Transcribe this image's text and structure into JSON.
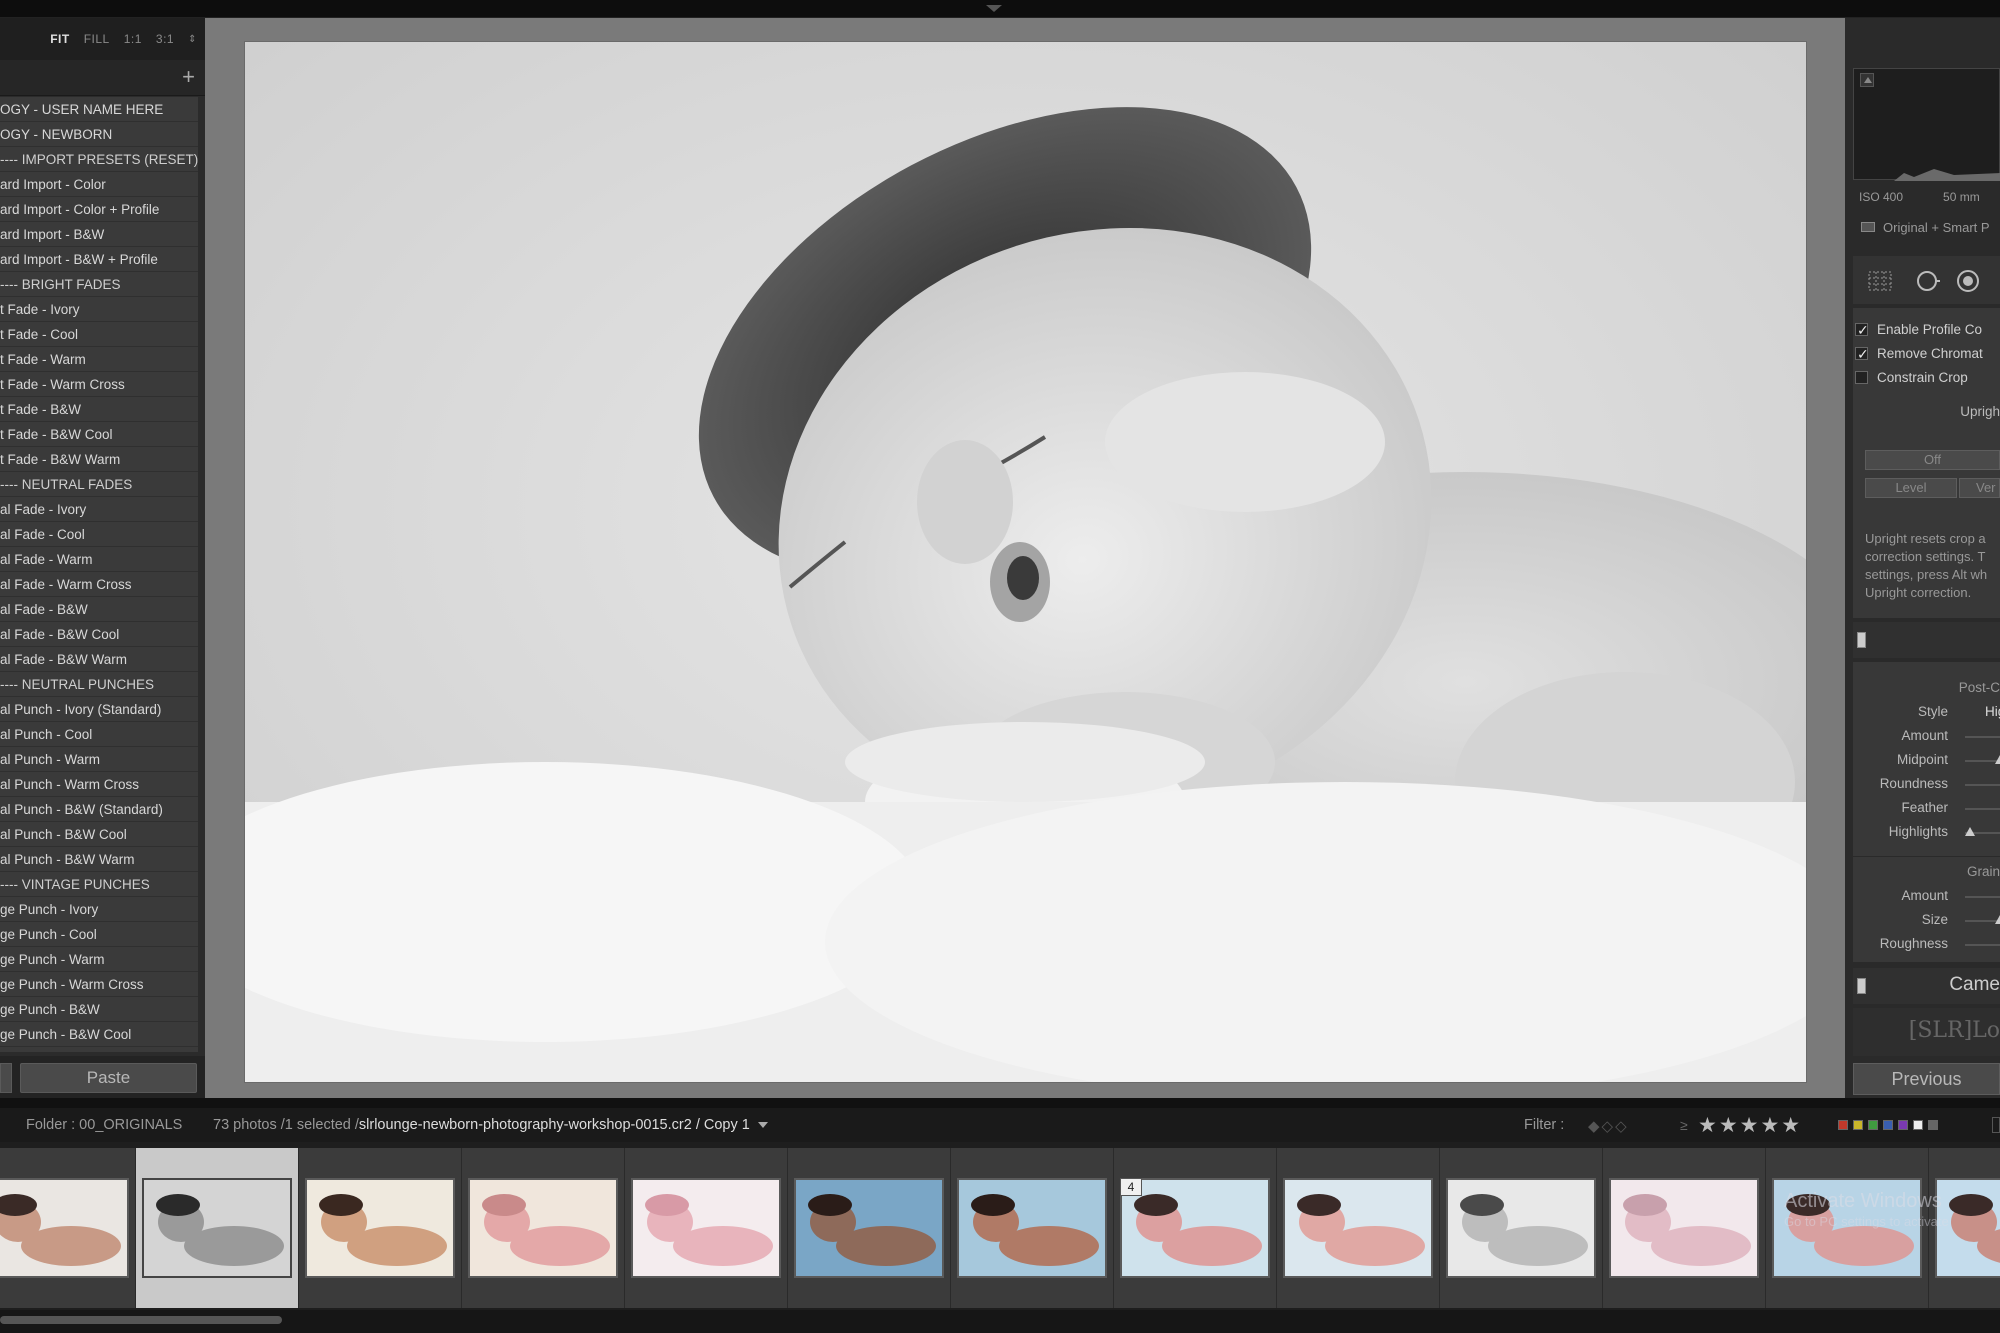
{
  "zoom": {
    "fit": "FIT",
    "fill": "FILL",
    "one": "1:1",
    "three": "3:1"
  },
  "presets": [
    {
      "label": "OGY - USER NAME HERE",
      "folder": false
    },
    {
      "label": "OGY - NEWBORN",
      "folder": false
    },
    {
      "label": "---- IMPORT PRESETS (RESET)",
      "folder": true
    },
    {
      "label": "ard Import - Color",
      "folder": false
    },
    {
      "label": "ard Import - Color + Profile",
      "folder": false
    },
    {
      "label": "ard Import - B&W",
      "folder": false
    },
    {
      "label": "ard Import - B&W + Profile",
      "folder": false
    },
    {
      "label": "---- BRIGHT FADES",
      "folder": true
    },
    {
      "label": "t Fade - Ivory",
      "folder": false
    },
    {
      "label": "t Fade - Cool",
      "folder": false
    },
    {
      "label": "t Fade - Warm",
      "folder": false
    },
    {
      "label": "t Fade - Warm Cross",
      "folder": false
    },
    {
      "label": "t Fade - B&W",
      "folder": false
    },
    {
      "label": "t Fade - B&W Cool",
      "folder": false
    },
    {
      "label": "t Fade - B&W Warm",
      "folder": false
    },
    {
      "label": "---- NEUTRAL FADES",
      "folder": true
    },
    {
      "label": "al Fade - Ivory",
      "folder": false
    },
    {
      "label": "al Fade - Cool",
      "folder": false
    },
    {
      "label": "al Fade - Warm",
      "folder": false
    },
    {
      "label": "al Fade - Warm Cross",
      "folder": false
    },
    {
      "label": "al Fade - B&W",
      "folder": false
    },
    {
      "label": "al Fade - B&W Cool",
      "folder": false
    },
    {
      "label": "al Fade - B&W Warm",
      "folder": false
    },
    {
      "label": "---- NEUTRAL PUNCHES",
      "folder": true
    },
    {
      "label": "al Punch - Ivory (Standard)",
      "folder": false
    },
    {
      "label": "al Punch - Cool",
      "folder": false
    },
    {
      "label": "al Punch - Warm",
      "folder": false
    },
    {
      "label": "al Punch - Warm Cross",
      "folder": false
    },
    {
      "label": "al Punch - B&W (Standard)",
      "folder": false
    },
    {
      "label": "al Punch - B&W Cool",
      "folder": false
    },
    {
      "label": "al Punch - B&W Warm",
      "folder": false
    },
    {
      "label": "---- VINTAGE PUNCHES",
      "folder": true
    },
    {
      "label": "ge Punch - Ivory",
      "folder": false
    },
    {
      "label": "ge Punch - Cool",
      "folder": false
    },
    {
      "label": "ge Punch - Warm",
      "folder": false
    },
    {
      "label": "ge Punch - Warm Cross",
      "folder": false
    },
    {
      "label": "ge Punch - B&W",
      "folder": false
    },
    {
      "label": "ge Punch - B&W Cool",
      "folder": false
    }
  ],
  "paste_label": "Paste",
  "histogram": {
    "iso": "ISO 400",
    "focal": "50 mm"
  },
  "original_smart": "Original + Smart P",
  "lens": {
    "enable_profile": "Enable Profile Co",
    "remove_chroma": "Remove Chromat",
    "constrain_crop": "Constrain Crop",
    "upright": "Uprigh",
    "off": "Off",
    "level": "Level",
    "ver": "Ver",
    "note": [
      "Upright resets crop a",
      "correction settings. T",
      "settings, press Alt wh",
      "Upright correction."
    ]
  },
  "effects": {
    "post_crop": "Post-C",
    "style_label": "Style",
    "style_value": "Hig",
    "amount": "Amount",
    "midpoint": "Midpoint",
    "roundness": "Roundness",
    "feather": "Feather",
    "highlights": "Highlights",
    "grain": "Grain",
    "grain_amount": "Amount",
    "size": "Size",
    "roughness": "Roughness"
  },
  "camera_title": "Came",
  "logo": "[SLR]Lo",
  "previous_label": "Previous",
  "info": {
    "folder": "Folder : 00_ORIGINALS",
    "count": "73 photos /1 selected /",
    "filename": "slrlounge-newborn-photography-workshop-0015.cr2 / Copy 1",
    "filter": "Filter :",
    "ge": "≥",
    "stars": "★★★★★"
  },
  "swatch_colors": [
    "#c0392b",
    "#c9b52a",
    "#3f9a3f",
    "#3a5fb0",
    "#7a3ab0",
    "#eeeeee",
    "#666666"
  ],
  "thumb_badge": "4",
  "watermark": {
    "line1": "Activate Windows",
    "line2": "Go to PC settings to activate"
  },
  "film_tones": [
    {
      "bg": "#eae6e2",
      "skin": "#c89a86",
      "dark": "#3a2a26"
    },
    {
      "bg": "#d4d4d4",
      "skin": "#9a9a9a",
      "dark": "#2a2a2a"
    },
    {
      "bg": "#efe9de",
      "skin": "#d0a080",
      "dark": "#3a2820"
    },
    {
      "bg": "#f0e6dc",
      "skin": "#e4a8a8",
      "dark": "#c98a8a"
    },
    {
      "bg": "#f4ecee",
      "skin": "#e8b4bc",
      "dark": "#d89aa6"
    },
    {
      "bg": "#7aa6c6",
      "skin": "#8e6a5a",
      "dark": "#2a1c18"
    },
    {
      "bg": "#a6c8dc",
      "skin": "#b07a66",
      "dark": "#2a1c18"
    },
    {
      "bg": "#cfe2ec",
      "skin": "#dca0a0",
      "dark": "#3a2a28"
    },
    {
      "bg": "#dbe7ee",
      "skin": "#e0a8a4",
      "dark": "#3a2a28"
    },
    {
      "bg": "#e8e8e8",
      "skin": "#bdbdbd",
      "dark": "#4a4a4a"
    },
    {
      "bg": "#f2e8ec",
      "skin": "#e2bcc6",
      "dark": "#c8a0ac"
    },
    {
      "bg": "#b8d4e6",
      "skin": "#d8a0a0",
      "dark": "#3a2a28"
    },
    {
      "bg": "#c4dcec",
      "skin": "#c89088",
      "dark": "#3a2a28"
    }
  ]
}
